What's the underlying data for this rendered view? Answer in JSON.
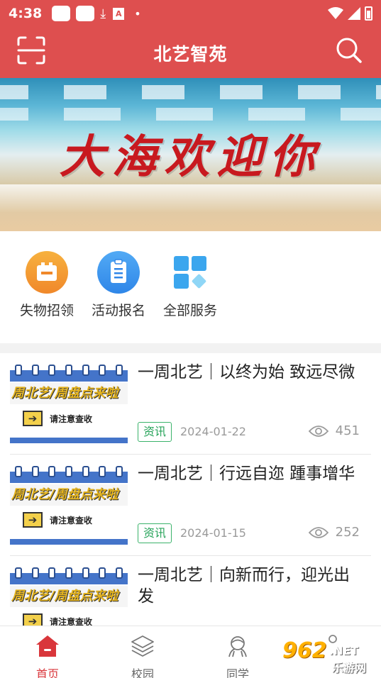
{
  "status_bar": {
    "time": "4:38",
    "icons": [
      "notification-box",
      "notification-box",
      "download-icon",
      "accessibility-icon",
      "dot",
      "wifi-icon",
      "signal-icon",
      "battery-icon"
    ]
  },
  "header": {
    "title": "北艺智苑",
    "left_icon": "scan-icon",
    "right_icon": "search-icon",
    "bg_color": "#de4f4f"
  },
  "banner": {
    "slogan": "大海欢迎你"
  },
  "services": [
    {
      "label": "失物招领",
      "icon": "lost-found-icon",
      "color": "#f29d2d"
    },
    {
      "label": "活动报名",
      "icon": "clipboard-icon",
      "color": "#3d98ef"
    },
    {
      "label": "全部服务",
      "icon": "grid-icon",
      "color": "#41b8ef"
    }
  ],
  "news": [
    {
      "title": "一周北艺｜以终为始 致远尽微",
      "tag": "资讯",
      "date": "2024-01-22",
      "views": "451",
      "thumb_headline": "周北艺/周盘点来啦",
      "thumb_notice": "请注意查收"
    },
    {
      "title": "一周北艺｜行远自迩 踵事增华",
      "tag": "资讯",
      "date": "2024-01-15",
      "views": "252",
      "thumb_headline": "周北艺/周盘点来啦",
      "thumb_notice": "请注意查收"
    },
    {
      "title": "一周北艺｜向新而行，迎光出发",
      "tag": "",
      "date": "",
      "views": "",
      "thumb_headline": "周北艺/周盘点来啦",
      "thumb_notice": "请注意查收"
    }
  ],
  "tabs": [
    {
      "label": "首页",
      "icon": "home-icon",
      "active": true
    },
    {
      "label": "校园",
      "icon": "layers-icon",
      "active": false
    },
    {
      "label": "同学",
      "icon": "classmates-icon",
      "active": false
    },
    {
      "label": "",
      "icon": "profile-icon",
      "active": false
    }
  ],
  "watermark": {
    "number": "962",
    "domain": ".NET",
    "site": "乐游网"
  },
  "colors": {
    "accent": "#de4f4f",
    "tag_green": "#27a35a",
    "active_tab": "#d9363b"
  }
}
